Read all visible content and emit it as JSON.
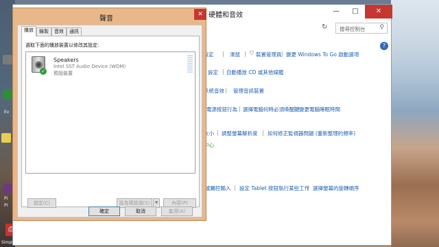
{
  "control_panel": {
    "title": "硬體和音效",
    "search_placeholder": "搜尋控制台",
    "minimize": "—",
    "maximize": "□",
    "close": "✕",
    "help": "?",
    "links": {
      "row1": [
        "輸設定",
        "滑鼠",
        "裝置管理員",
        "變更 Windows To Go 啟動選項"
      ],
      "row2": [
        "設定",
        "自動播放 CD 或其他媒體"
      ],
      "row3": [
        "系統音效",
        "管理音訊裝置"
      ],
      "row4": [
        "電源按鈕行為",
        "變更電腦睡眠時間",
        "選擇電腦何時必須喚醒鍵"
      ],
      "row5": [
        "大小",
        "調整螢幕解析度",
        "如何修正監視器問題 (重新整理的頻率)"
      ],
      "row6": [
        "中心"
      ],
      "row7": [
        "或觸控輸入",
        "設定 Tablet 按鈕執行某些工作",
        "選擇螢幕的旋轉順序"
      ]
    }
  },
  "sound_dialog": {
    "title": "聲音",
    "close": "✕",
    "tabs": [
      "播放",
      "錄製",
      "音效",
      "通訊"
    ],
    "instruction": "選取下面的播放裝置以修改其設定:",
    "devices": [
      {
        "name": "Speakers",
        "driver": "Intel SST Audio Device (WDM)",
        "status": "預設裝置"
      }
    ],
    "buttons": {
      "configure": "設定(C)",
      "set_default": "設為預設值(S)",
      "dropdown": "▼",
      "properties": "內容(P)",
      "ok": "確定",
      "cancel": "取消",
      "apply": "套用(A)"
    }
  },
  "desktop": {
    "labels": [
      "Ev",
      "Pi",
      "Pi",
      "SimpleRe..."
    ]
  }
}
